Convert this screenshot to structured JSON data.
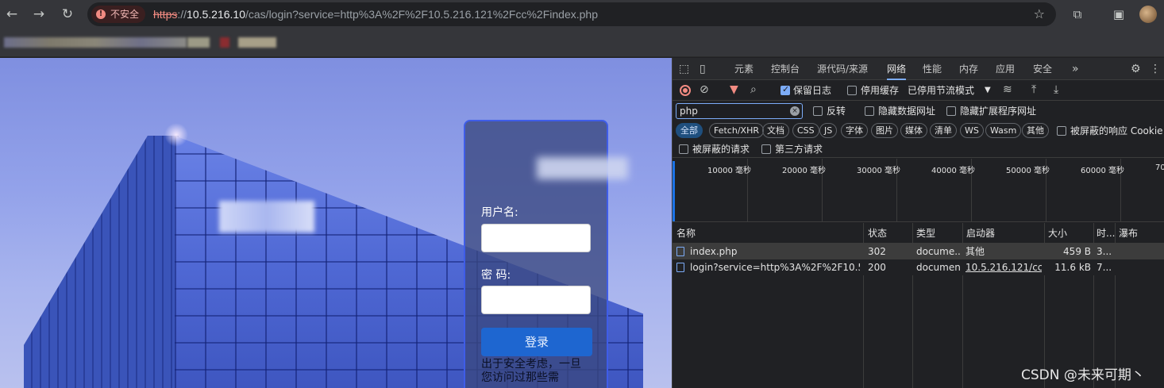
{
  "browser": {
    "security_label": "不安全",
    "url_scheme": "https",
    "url_sep": "://",
    "url_host": "10.5.216.10",
    "url_path": "/cas/login?service=http%3A%2F%2F10.5.216.121%2Fcc%2Findex.php"
  },
  "login": {
    "username_label": "用户名:",
    "password_label": "密    码:",
    "submit_label": "登录",
    "notice": "出于安全考虑，一旦您访问过那些需"
  },
  "devtools": {
    "tabs": [
      "元素",
      "控制台",
      "源代码/来源",
      "网络",
      "性能",
      "内存",
      "应用",
      "安全"
    ],
    "active_tab": "网络",
    "toolbar": {
      "preserve_log": "保留日志",
      "disable_cache": "停用缓存",
      "throttle": "已停用节流模式"
    },
    "filter": {
      "value": "php",
      "invert": "反转",
      "hide_data_urls": "隐藏数据网址",
      "hide_ext_urls": "隐藏扩展程序网址"
    },
    "type_chips": [
      "全部",
      "Fetch/XHR",
      "文档",
      "CSS",
      "JS",
      "字体",
      "图片",
      "媒体",
      "清单",
      "WS",
      "Wasm",
      "其他"
    ],
    "blocked_cookies": "被屏蔽的响应 Cookie",
    "blocked_requests": "被屏蔽的请求",
    "third_party": "第三方请求",
    "timeline_ticks": [
      "10000 毫秒",
      "20000 毫秒",
      "30000 毫秒",
      "40000 毫秒",
      "50000 毫秒",
      "60000 毫秒",
      "700"
    ],
    "columns": [
      "名称",
      "状态",
      "类型",
      "启动器",
      "大小",
      "时...",
      "瀑布"
    ],
    "rows": [
      {
        "name": "index.php",
        "status": "302",
        "type": "docume...",
        "initiator": "其他",
        "size": "459 B",
        "time": "3..."
      },
      {
        "name": "login?service=http%3A%2F%2F10.5.21...",
        "status": "200",
        "type": "document",
        "initiator": "10.5.216.121/cc/...",
        "size": "11.6 kB",
        "time": "7..."
      }
    ]
  },
  "watermark": "CSDN @未来可期丶"
}
